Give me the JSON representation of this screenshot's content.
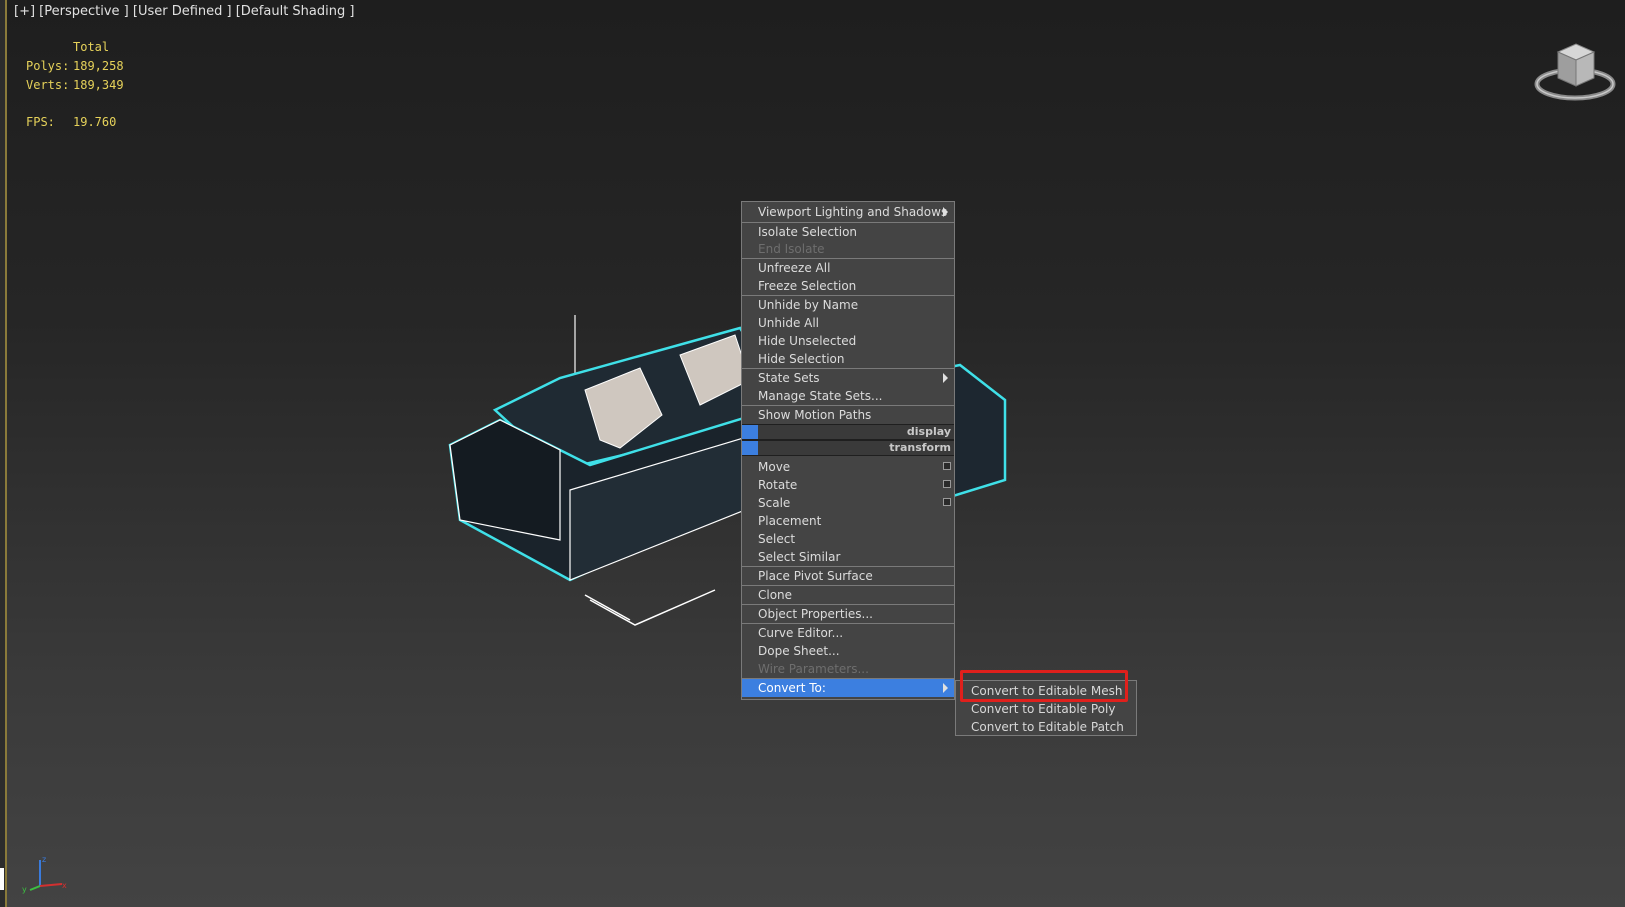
{
  "viewport": {
    "label": "[+] [Perspective ] [User Defined ] [Default Shading ]"
  },
  "stats": {
    "total_header": "Total",
    "polys_label": "Polys:",
    "polys_value": "189,258",
    "verts_label": "Verts:",
    "verts_value": "189,349",
    "fps_label": "FPS:",
    "fps_value": "19.760"
  },
  "quad_menu": {
    "items": [
      {
        "label": "Viewport Lighting and Shadows",
        "submenu": true
      },
      {
        "label": "Isolate Selection"
      },
      {
        "label": "End Isolate",
        "disabled": true
      },
      {
        "label": "Unfreeze All"
      },
      {
        "label": "Freeze Selection"
      },
      {
        "label": "Unhide by Name"
      },
      {
        "label": "Unhide All"
      },
      {
        "label": "Hide Unselected"
      },
      {
        "label": "Hide Selection"
      },
      {
        "label": "State Sets",
        "submenu": true
      },
      {
        "label": "Manage State Sets..."
      },
      {
        "label": "Show Motion Paths"
      },
      {
        "label": "Move",
        "options_box": true
      },
      {
        "label": "Rotate",
        "options_box": true
      },
      {
        "label": "Scale",
        "options_box": true
      },
      {
        "label": "Placement"
      },
      {
        "label": "Select"
      },
      {
        "label": "Select Similar"
      },
      {
        "label": "Place Pivot Surface"
      },
      {
        "label": "Clone"
      },
      {
        "label": "Object Properties..."
      },
      {
        "label": "Curve Editor..."
      },
      {
        "label": "Dope Sheet..."
      },
      {
        "label": "Wire Parameters...",
        "disabled": true
      },
      {
        "label": "Convert To:",
        "submenu": true,
        "highlighted": true
      }
    ],
    "headers": [
      "display",
      "transform"
    ]
  },
  "submenu": {
    "items": [
      {
        "label": "Convert to Editable Mesh"
      },
      {
        "label": "Convert to Editable Poly"
      },
      {
        "label": "Convert to Editable Patch"
      }
    ]
  },
  "colors": {
    "highlight": "#3c7fe0",
    "stats_text": "#e6d25a",
    "selection_outline": "#3fe0e8",
    "annotation_red": "#e0201c"
  }
}
